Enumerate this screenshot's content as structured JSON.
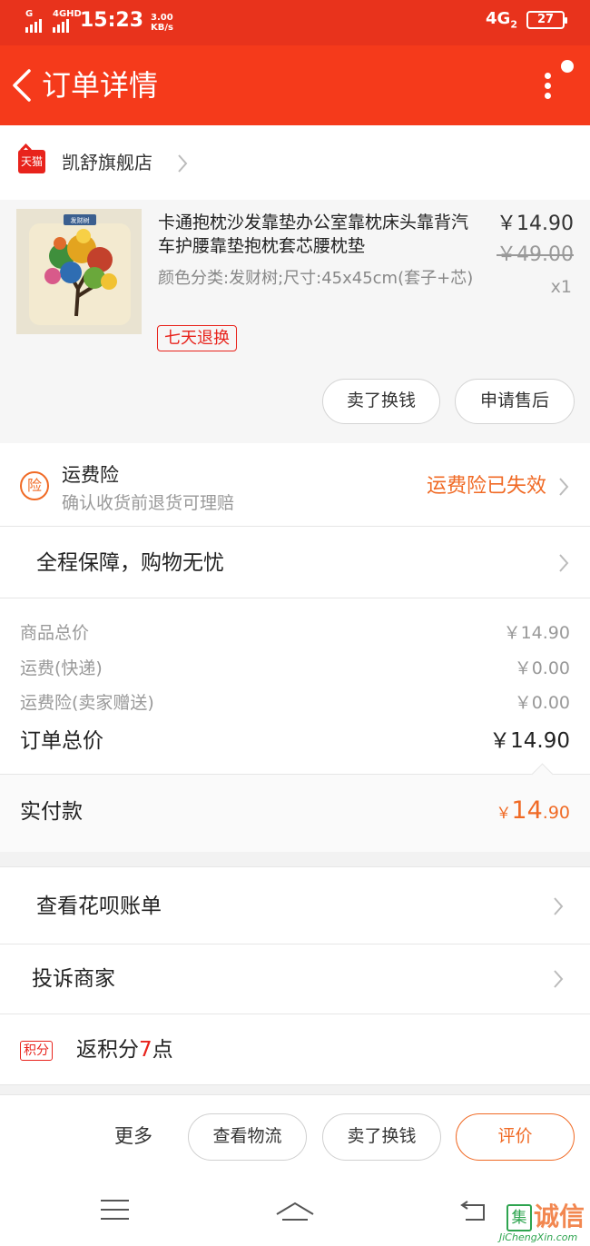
{
  "status_bar": {
    "sig1_tag": "G",
    "sig2_tag": "4GHD",
    "time": "15:23",
    "speed_value": "3.00",
    "speed_unit": "KB/s",
    "network": "4G",
    "network_sub": "2",
    "battery": "27"
  },
  "header": {
    "title": "订单详情"
  },
  "store": {
    "badge": "天猫",
    "name": "凯舒旗舰店"
  },
  "product": {
    "image_tag": "发财树",
    "title": "卡通抱枕沙发靠垫办公室靠枕床头靠背汽车护腰靠垫抱枕套芯腰枕垫",
    "sku": "颜色分类:发财树;尺寸:45x45cm(套子+芯)",
    "tag": "七天退换",
    "price": "￥14.90",
    "original_price": "￥49.00",
    "quantity": "x1",
    "buttons": {
      "sell": "卖了换钱",
      "after_sale": "申请售后"
    }
  },
  "insurance": {
    "icon": "险",
    "title": "运费险",
    "subtitle": "确认收货前退货可理赔",
    "status": "运费险已失效"
  },
  "guarantee": {
    "label": "全程保障，购物无忧"
  },
  "fees": {
    "goods_label": "商品总价",
    "goods_value": "￥14.90",
    "shipping_label": "运费(快递)",
    "shipping_value": "￥0.00",
    "insurance_label": "运费险(卖家赠送)",
    "insurance_value": "￥0.00",
    "total_label": "订单总价",
    "total_value": "￥14.90"
  },
  "paid": {
    "label": "实付款",
    "currency": "￥",
    "integer": "14",
    "decimal": ".90"
  },
  "links": {
    "huabei": "查看花呗账单",
    "complaint": "投诉商家"
  },
  "points": {
    "tag": "积分",
    "prefix": "返积分",
    "count": "7",
    "suffix": "点"
  },
  "actions": {
    "more": "更多",
    "logistics": "查看物流",
    "sell": "卖了换钱",
    "review": "评价"
  },
  "watermark": {
    "char_box": "集",
    "chars": "诚信",
    "site": "JiChengXin.com"
  },
  "colors": {
    "brand_red": "#f53a1b",
    "accent_orange": "#f06a25"
  }
}
